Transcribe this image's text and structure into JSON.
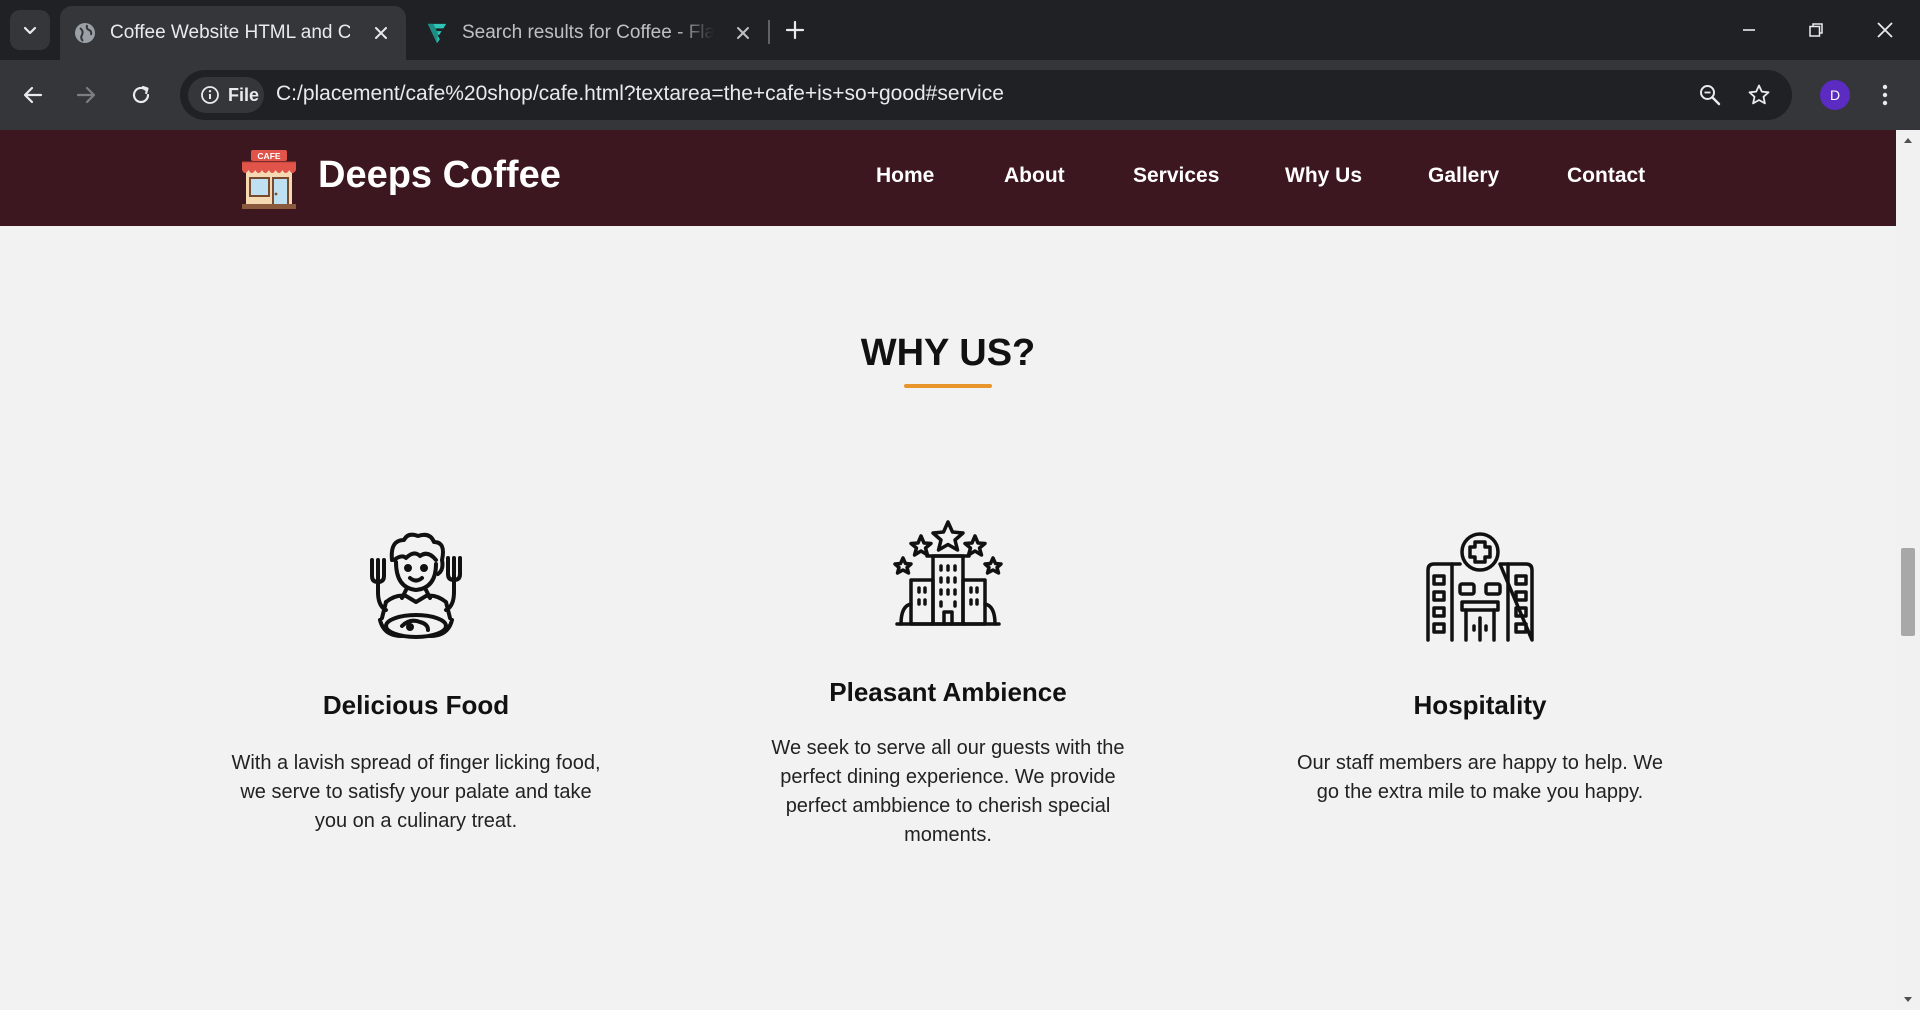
{
  "browser": {
    "tabs": [
      {
        "title": "Coffee Website HTML and CSS",
        "favicon": "globe-icon",
        "active": true
      },
      {
        "title": "Search results for Coffee - Flaticon",
        "favicon": "flaticon-logo-icon",
        "active": false
      }
    ],
    "url_chip": "File",
    "url": "C:/placement/cafe%20shop/cafe.html?textarea=the+cafe+is+so+good#service",
    "profile_initial": "D",
    "accent": "#5b2bc2"
  },
  "site": {
    "brand": "Deeps Coffee",
    "logo_sign": "CAFE",
    "header_color": "#3c1720",
    "nav": [
      "Home",
      "About",
      "Services",
      "Why Us",
      "Gallery",
      "Contact"
    ]
  },
  "section": {
    "title": "WHY US?",
    "underline_color": "#e8962c",
    "cards": [
      {
        "icon": "chef-eating-icon",
        "title": "Delicious Food",
        "text": "With a lavish spread of finger licking food, we serve to satisfy your palate and take you on a culinary treat."
      },
      {
        "icon": "five-star-hotel-icon",
        "title": "Pleasant Ambience",
        "text": "We seek to serve all our guests with the perfect dining experience. We provide perfect ambbience to cherish special moments."
      },
      {
        "icon": "hospital-building-icon",
        "title": "Hospitality",
        "text": "Our staff members are happy to help. We go the extra mile to make you happy."
      }
    ]
  }
}
